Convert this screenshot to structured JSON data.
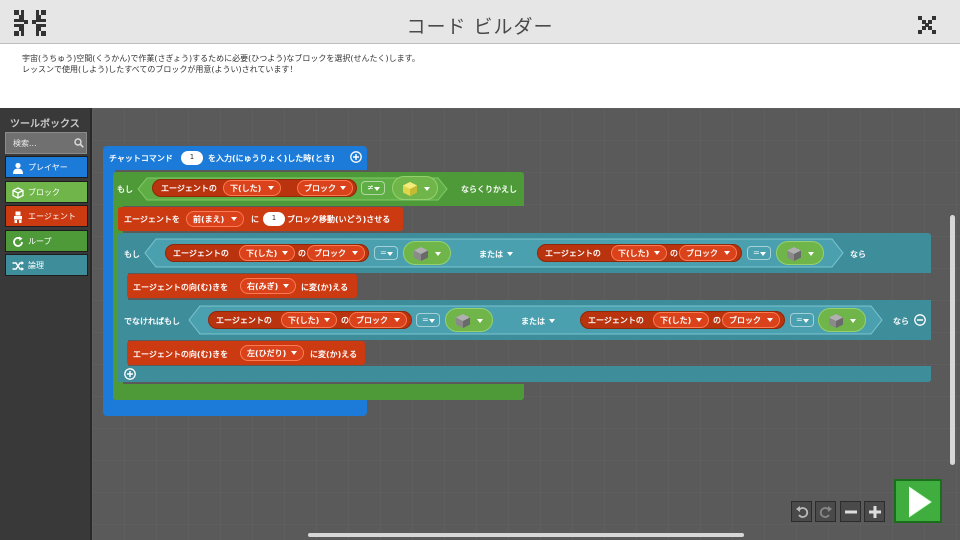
{
  "window": {
    "title": "コード ビルダー",
    "instructions": [
      "宇宙(うちゅう)空間(くうかん)で作業(さぎょう)するために必要(ひつよう)なブロックを選択(せんたく)します。",
      "レッスンで使用(しよう)したすべてのブロックが用意(ようい)されています！"
    ]
  },
  "toolbox": {
    "title": "ツールボックス",
    "search_placeholder": "検索...",
    "categories": [
      {
        "label": "プレイヤー",
        "color": "#1c7ad8",
        "icon": "person-icon"
      },
      {
        "label": "ブロック",
        "color": "#6fb54a",
        "icon": "cube-icon"
      },
      {
        "label": "エージェント",
        "color": "#cc3a12",
        "icon": "agent-icon"
      },
      {
        "label": "ループ",
        "color": "#4e9a38",
        "icon": "loop-icon"
      },
      {
        "label": "論理",
        "color": "#3d8d9b",
        "icon": "shuffle-icon"
      }
    ]
  },
  "blocks": {
    "event": {
      "prefix": "チャットコマンド",
      "value": "1",
      "suffix": "を入力(にゅうりょく)した時(とき)"
    },
    "loop": {
      "keyword": "もし",
      "suffix": "ならくりかえし",
      "agent": "エージェントの",
      "dir": "下(した)",
      "of": "の",
      "prop": "ブロック",
      "op": "≠"
    },
    "move": {
      "prefix": "エージェントを",
      "dir": "前(まえ)",
      "ni": "に",
      "value": "1",
      "suffix": "ブロック移動(いどう)させる"
    },
    "if": {
      "keyword": "もし",
      "agent": "エージェントの",
      "dir": "下(した)",
      "of": "の",
      "prop": "ブロック",
      "op": "=",
      "or": "または",
      "then": "なら"
    },
    "turn1": {
      "prefix": "エージェントの向(む)きを",
      "dir": "右(みぎ)",
      "suffix": "に変(か)える"
    },
    "elseif": {
      "keyword": "でなければもし",
      "agent": "エージェントの",
      "dir": "下(した)",
      "of": "の",
      "prop": "ブロック",
      "op": "=",
      "or": "または",
      "then": "なら"
    },
    "turn2": {
      "prefix": "エージェントの向(む)きを",
      "dir": "左(ひだり)",
      "suffix": "に変(か)える"
    }
  },
  "colors": {
    "event": "#1c7ad8",
    "loop": "#4e9a38",
    "agent": "#cc3a12",
    "logic": "#3d8d9b",
    "item": "#6fb54a",
    "run": "#3fae3f"
  }
}
